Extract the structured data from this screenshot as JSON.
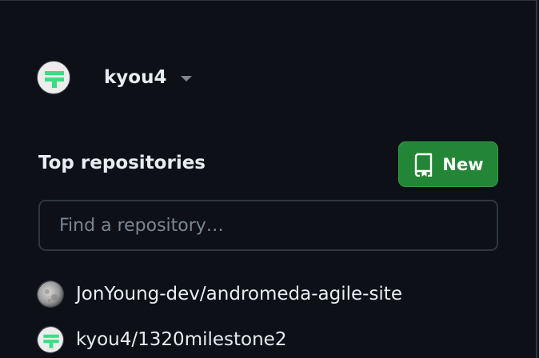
{
  "account": {
    "username": "kyou4",
    "avatar_icon": "identicon-green",
    "dropdown_icon": "caret-down-icon"
  },
  "repositories": {
    "title": "Top repositories",
    "new_button_label": "New",
    "new_button_icon": "repo-icon",
    "search_placeholder": "Find a repository…",
    "items": [
      {
        "owner": "JonYoung-dev",
        "separator": "/",
        "name": "andromeda-agile-site",
        "avatar": "moon-avatar"
      },
      {
        "owner": "kyou4",
        "separator": "/",
        "name": "1320milestone2",
        "avatar": "identicon-green"
      }
    ]
  },
  "colors": {
    "background": "#0d1117",
    "text": "#e6edf3",
    "muted": "#7d8590",
    "border": "#30363d",
    "button_green": "#238636",
    "identicon_green": "#3ddc84"
  }
}
